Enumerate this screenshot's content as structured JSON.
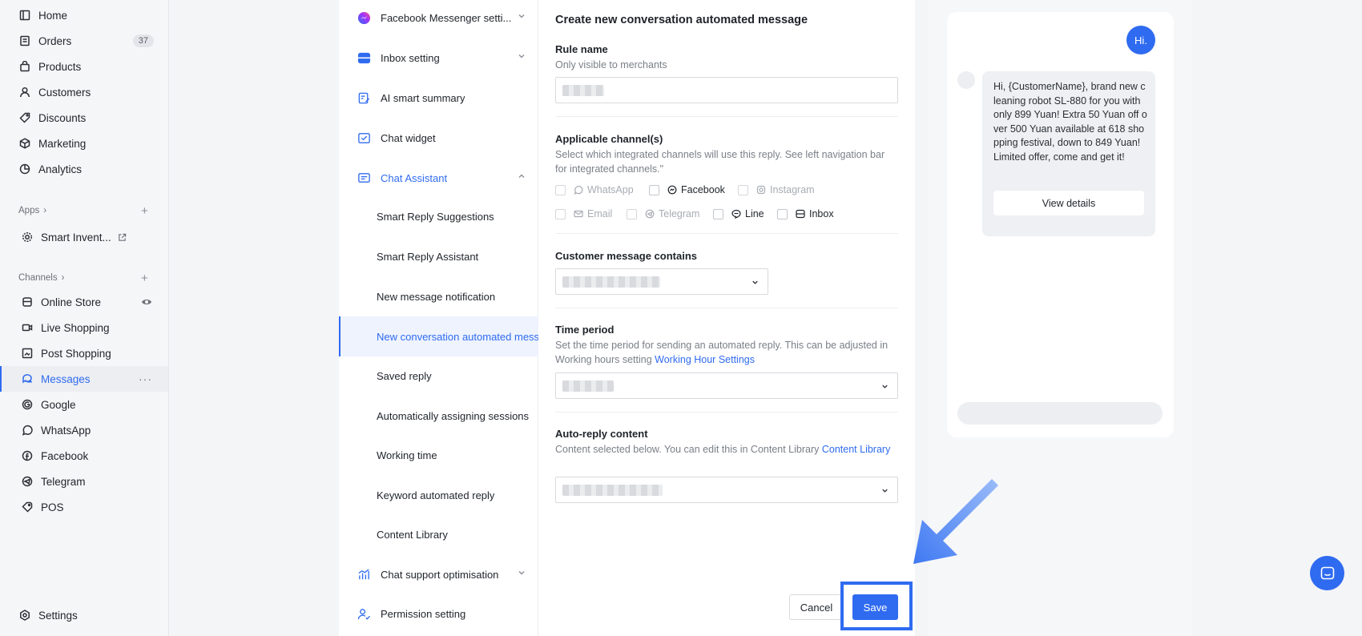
{
  "nav": {
    "items": [
      {
        "label": "Home",
        "icon": "home-icon"
      },
      {
        "label": "Orders",
        "icon": "orders-icon",
        "badge": "37"
      },
      {
        "label": "Products",
        "icon": "bag-icon"
      },
      {
        "label": "Customers",
        "icon": "person-icon"
      },
      {
        "label": "Discounts",
        "icon": "tag-icon"
      },
      {
        "label": "Marketing",
        "icon": "marketing-icon"
      },
      {
        "label": "Analytics",
        "icon": "pie-chart-icon"
      }
    ],
    "apps_label": "Apps",
    "apps_items": [
      {
        "label": "Smart Invent...",
        "icon": "gear-icon"
      }
    ],
    "channels_label": "Channels",
    "channel_items": [
      {
        "label": "Online Store",
        "icon": "store-icon"
      },
      {
        "label": "Live Shopping",
        "icon": "video-icon"
      },
      {
        "label": "Post Shopping",
        "icon": "post-icon"
      },
      {
        "label": "Messages",
        "icon": "chat-icon"
      },
      {
        "label": "Google",
        "icon": "google-icon"
      },
      {
        "label": "WhatsApp",
        "icon": "whatsapp-icon"
      },
      {
        "label": "Facebook",
        "icon": "facebook-icon"
      },
      {
        "label": "Telegram",
        "icon": "telegram-icon"
      },
      {
        "label": "POS",
        "icon": "pos-tag-icon"
      }
    ],
    "settings_label": "Settings",
    "more_label": "···"
  },
  "submenu": {
    "items": [
      {
        "label": "Facebook Messenger setti..."
      },
      {
        "label": "Inbox setting"
      },
      {
        "label": "AI smart summary"
      },
      {
        "label": "Chat widget"
      },
      {
        "label": "Chat Assistant"
      },
      {
        "label": "Smart Reply Suggestions"
      },
      {
        "label": "Smart Reply Assistant"
      },
      {
        "label": "New message notification"
      },
      {
        "label": "New conversation automated message"
      },
      {
        "label": "Saved reply"
      },
      {
        "label": "Automatically assigning sessions"
      },
      {
        "label": "Working time"
      },
      {
        "label": "Keyword automated reply"
      },
      {
        "label": "Content Library"
      },
      {
        "label": "Chat support optimisation"
      },
      {
        "label": "Permission setting"
      }
    ]
  },
  "form": {
    "title": "Create new conversation automated message",
    "rule_name_label": "Rule name",
    "rule_name_help": "Only visible to merchants",
    "channels_label": "Applicable channel(s)",
    "channels_help": "Select which integrated channels will use this reply. See left navigation bar for integrated channels.\"",
    "channels": [
      {
        "label": "WhatsApp",
        "icon": "whatsapp-icon"
      },
      {
        "label": "Facebook",
        "icon": "messenger-icon"
      },
      {
        "label": "Instagram",
        "icon": "instagram-icon"
      },
      {
        "label": "Email",
        "icon": "email-icon"
      },
      {
        "label": "Telegram",
        "icon": "telegram-icon"
      },
      {
        "label": "Line",
        "icon": "line-icon"
      },
      {
        "label": "Inbox",
        "icon": "inbox-icon"
      }
    ],
    "contains_label": "Customer message contains",
    "time_label": "Time period",
    "time_help": "Set the time period for sending an automated reply. This can be adjusted in Working hours setting",
    "time_link": "Working Hour Settings",
    "auto_label": "Auto-reply content",
    "auto_help": "Content selected below. You can edit this in Content Library",
    "auto_link": "Content Library",
    "cancel_label": "Cancel",
    "save_label": "Save"
  },
  "preview": {
    "hi": "Hi.",
    "message": "Hi, {CustomerName}, brand new cleaning robot SL-880 for you with only 899 Yuan! Extra 50 Yuan off over 500 Yuan available at 618 shopping festival, down to 849 Yuan! Limited offer, come and get it!",
    "view_details": "View details"
  },
  "colors": {
    "accent": "#2f6bf0",
    "arrow": "#4f86f7"
  }
}
